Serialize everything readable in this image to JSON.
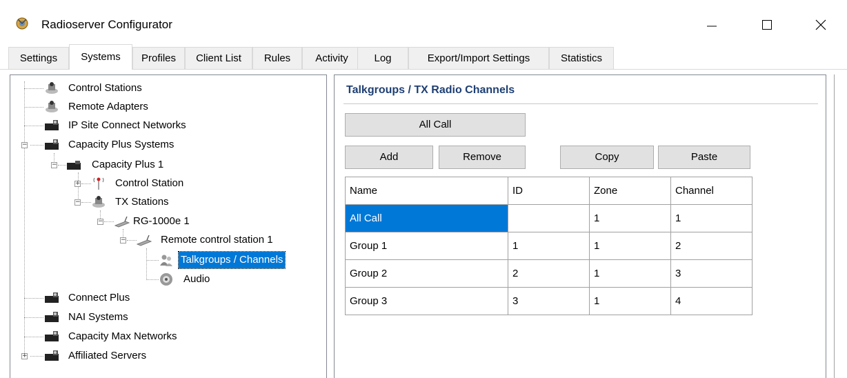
{
  "window": {
    "title": "Radioserver Configurator",
    "icon": "app-logo-icon"
  },
  "tabs": [
    {
      "label": "Settings",
      "active": false
    },
    {
      "label": "Systems",
      "active": true
    },
    {
      "label": "Profiles",
      "active": false
    },
    {
      "label": "Client List",
      "active": false
    },
    {
      "label": "Rules",
      "active": false
    },
    {
      "label": "Activity",
      "active": false
    },
    {
      "label": "Log",
      "active": false
    },
    {
      "label": "Export/Import Settings",
      "active": false
    },
    {
      "label": "Statistics",
      "active": false
    }
  ],
  "tree": [
    {
      "label": "Control Stations",
      "icon": "station-icon"
    },
    {
      "label": "Remote Adapters",
      "icon": "station-icon"
    },
    {
      "label": "IP Site Connect Networks",
      "icon": "network-icon"
    },
    {
      "label": "Capacity Plus Systems",
      "icon": "network-icon"
    },
    {
      "label": "Capacity Plus 1",
      "icon": "network-icon"
    },
    {
      "label": "Control Station",
      "icon": "antenna-icon"
    },
    {
      "label": "TX Stations",
      "icon": "station-icon"
    },
    {
      "label": "RG-1000e 1",
      "icon": "radio-icon"
    },
    {
      "label": "Remote control station 1",
      "icon": "radio-icon"
    },
    {
      "label": "Talkgroups / Channels",
      "icon": "talkgroup-icon",
      "selected": true
    },
    {
      "label": "Audio",
      "icon": "speaker-icon"
    },
    {
      "label": "Connect Plus",
      "icon": "network-icon"
    },
    {
      "label": "NAI Systems",
      "icon": "network-icon"
    },
    {
      "label": "Capacity Max Networks",
      "icon": "network-icon"
    },
    {
      "label": "Affiliated Servers",
      "icon": "network-icon"
    }
  ],
  "panel": {
    "title": "Talkgroups / TX Radio Channels",
    "all_call_button": "All Call",
    "add_button": "Add",
    "remove_button": "Remove",
    "copy_button": "Copy",
    "paste_button": "Paste"
  },
  "table": {
    "columns": [
      "Name",
      "ID",
      "Zone",
      "Channel"
    ],
    "rows": [
      [
        "All Call",
        "",
        "1",
        "1"
      ],
      [
        "Group 1",
        "1",
        "1",
        "2"
      ],
      [
        "Group 2",
        "2",
        "1",
        "3"
      ],
      [
        "Group 3",
        "3",
        "1",
        "4"
      ]
    ],
    "selected_row": 0
  }
}
